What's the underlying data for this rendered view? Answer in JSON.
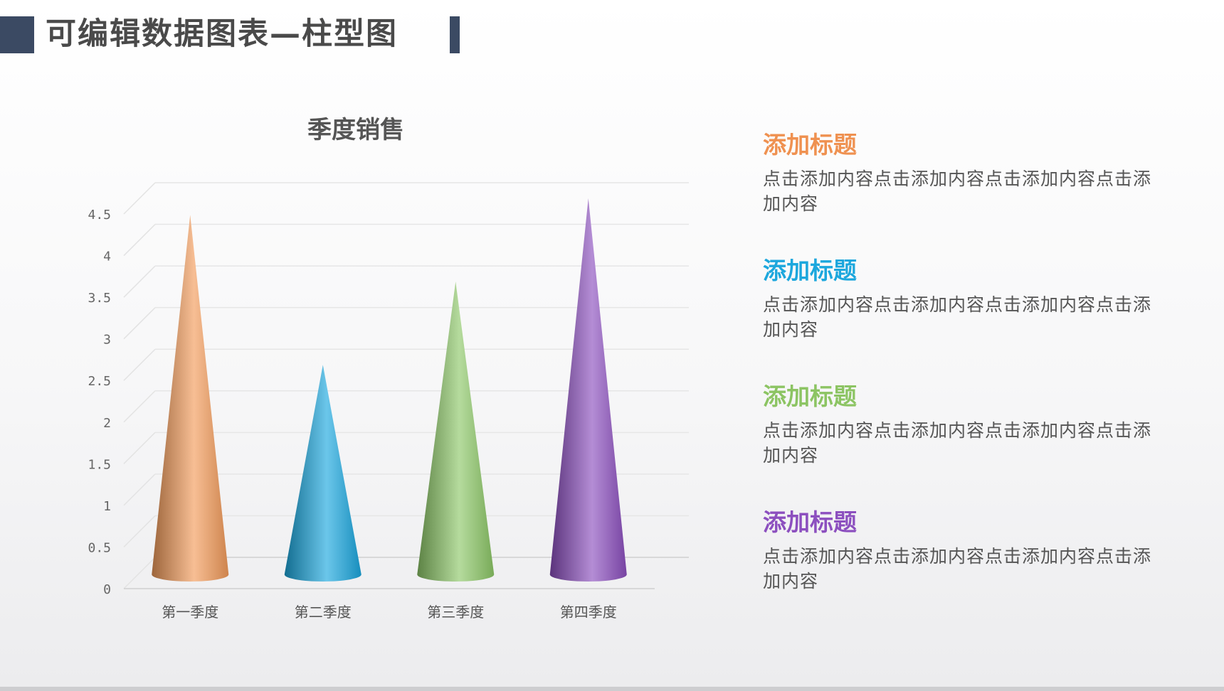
{
  "header": {
    "title": "可编辑数据图表—柱型图"
  },
  "chart_data": {
    "type": "bar",
    "title": "季度销售",
    "categories": [
      "第一季度",
      "第二季度",
      "第三季度",
      "第四季度"
    ],
    "values": [
      4.3,
      2.5,
      3.5,
      4.5
    ],
    "ylim": [
      0,
      4.5
    ],
    "yticks": [
      "0",
      "0.5",
      "1",
      "1.5",
      "2",
      "2.5",
      "3",
      "3.5",
      "4",
      "4.5"
    ],
    "colors": [
      "#f29b5a",
      "#1ba7de",
      "#8dc868",
      "#8c4fbf"
    ],
    "grid": true,
    "legend": "none"
  },
  "side": {
    "items": [
      {
        "heading": "添加标题",
        "body": "点击添加内容点击添加内容点击添加内容点击添加内容",
        "color": "#ef9150"
      },
      {
        "heading": "添加标题",
        "body": "点击添加内容点击添加内容点击添加内容点击添加内容",
        "color": "#1ca7dd"
      },
      {
        "heading": "添加标题",
        "body": "点击添加内容点击添加内容点击添加内容点击添加内容",
        "color": "#8cc463"
      },
      {
        "heading": "添加标题",
        "body": "点击添加内容点击添加内容点击添加内容点击添加内容",
        "color": "#8c4fbf"
      }
    ]
  }
}
